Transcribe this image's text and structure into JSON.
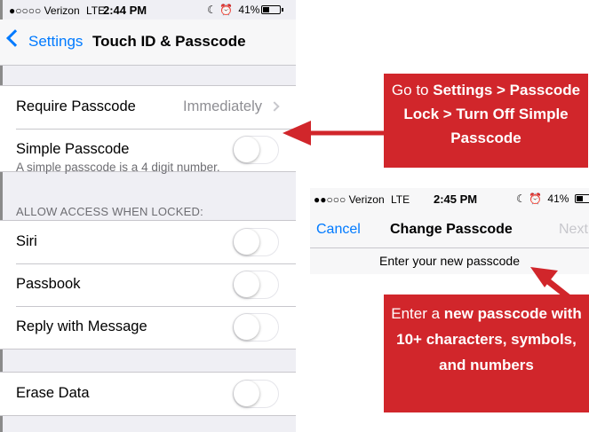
{
  "settings_screen": {
    "status_bar": {
      "signal": "●○○○○",
      "carrier": "Verizon",
      "network": "LTE",
      "time": "2:44 PM",
      "status_icons": "☾ ⏰",
      "battery_percent": "41%",
      "battery_level": 0.41
    },
    "nav": {
      "back_label": "Settings",
      "title": "Touch ID & Passcode"
    },
    "require_passcode": {
      "label": "Require Passcode",
      "value": "Immediately"
    },
    "simple_passcode": {
      "label": "Simple Passcode",
      "on": false
    },
    "simple_passcode_note": "A simple passcode is a 4 digit number.",
    "allow_access_header": "ALLOW ACCESS WHEN LOCKED:",
    "allow_access_items": [
      {
        "label": "Siri",
        "on": false
      },
      {
        "label": "Passbook",
        "on": false
      },
      {
        "label": "Reply with Message",
        "on": false
      }
    ],
    "erase_data": {
      "label": "Erase Data",
      "on": false
    }
  },
  "change_passcode_screen": {
    "status_bar": {
      "signal": "●●○○○",
      "carrier": "Verizon",
      "network": "LTE",
      "time": "2:45 PM",
      "status_icons": "☾ ⏰",
      "battery_percent": "41%"
    },
    "nav": {
      "cancel_label": "Cancel",
      "title": "Change Passcode",
      "next_label": "Next"
    },
    "prompt": "Enter your new passcode"
  },
  "callouts": {
    "top": {
      "prefix": "Go to ",
      "bold_1": "Settings > Passcode Lock > Turn Off Simple Passcode"
    },
    "bottom": {
      "prefix": "Enter a ",
      "bold_1": "new passcode with 10+ characters, symbols, and numbers"
    }
  },
  "colors": {
    "ios_blue": "#007aff",
    "callout_red": "#d1262b",
    "group_background": "#efeff4",
    "secondary_text": "#8e8e93"
  }
}
